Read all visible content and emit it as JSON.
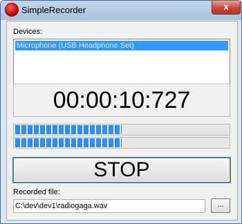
{
  "window": {
    "title": "SimpleRecorder",
    "close_glyph": "x"
  },
  "devices": {
    "label": "Devices:",
    "items": [
      {
        "label": "Microphone (USB Headphone Set)",
        "selected": true
      }
    ]
  },
  "timer": {
    "value": "00:00:10:727"
  },
  "meters": [
    {
      "name": "level-left",
      "fill_fraction": 0.5
    },
    {
      "name": "level-right",
      "fill_fraction": 0.5
    }
  ],
  "controls": {
    "stop_label": "STOP"
  },
  "recorded_file": {
    "label": "Recorded file:",
    "path": "C:\\dev\\dev1\\radiogaga.wav",
    "browse_label": "..."
  },
  "colors": {
    "selection": "#3399ff",
    "meter": "#2e8ef0",
    "record_icon": "#d00000"
  }
}
